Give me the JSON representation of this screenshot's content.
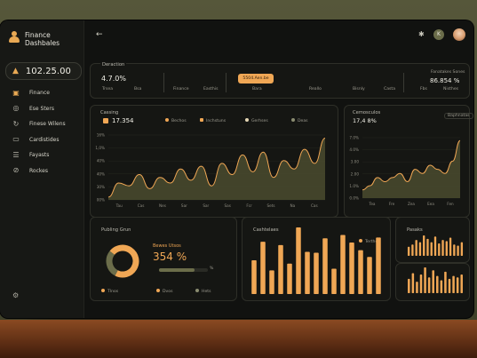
{
  "colors": {
    "accent": "#f0a755",
    "bg": "#111210",
    "panel": "#151613",
    "chart_fill": "#4a4b2f",
    "chart_line": "#f0a755"
  },
  "brand": {
    "name": "Finance Dashbales",
    "logo": "user-logo-icon"
  },
  "balance": {
    "icon": "arrow-up-icon",
    "value": "102.25.00"
  },
  "nav": [
    {
      "label": "Finance",
      "icon": "wallet-icon"
    },
    {
      "label": "Ese Sters",
      "icon": "chart-icon"
    },
    {
      "label": "Finese Wilens",
      "icon": "refresh-icon"
    },
    {
      "label": "Cardistides",
      "icon": "card-icon"
    },
    {
      "label": "Fayasts",
      "icon": "grid-icon"
    },
    {
      "label": "Rockes",
      "icon": "tag-icon"
    }
  ],
  "topbar": {
    "back": "←",
    "icon1": "sparkle-icon",
    "icon2": "K"
  },
  "summary": {
    "title": "Deraction",
    "big": "4.7.0%",
    "small_labels": [
      "Trsea",
      "Bsa"
    ],
    "mid_labels": [
      "Finance",
      "Easthis"
    ],
    "chip": "5504.Aen.be",
    "chip_sub": "Bara",
    "right_labels": [
      "Reallo",
      "Bisnly",
      "Casta"
    ],
    "right_top": "Fanatakes Sones",
    "right_big": "86.854 %",
    "right_sub": [
      "Fbs",
      "Nisthes"
    ]
  },
  "main_chart": {
    "title": "Cassing",
    "value": "17.354",
    "legend": [
      "Bechos",
      "Inchstuns",
      "Gerhses",
      "Deas"
    ]
  },
  "side_chart": {
    "title": "Cemosculos",
    "value": "17,4 8%",
    "badge": "Baphnatas"
  },
  "donut_panel": {
    "title": "Publing Grun",
    "label": "Bewes Utsos",
    "value": "354 %",
    "suffix": "%",
    "legend": [
      "Tlnos",
      "Dvos",
      "Hets"
    ]
  },
  "bar_panel": {
    "title": "Cashtelaes",
    "legend": "Terthes"
  },
  "mini_panel": {
    "title": "Pasaks"
  },
  "chart_data": [
    {
      "type": "area",
      "ylabels": [
        "16%",
        "1,0%",
        "40%",
        "40%",
        "30%",
        "00%"
      ],
      "x": [
        "Tau",
        "Cas",
        "Nes",
        "Sar",
        "Sar",
        "Sas",
        "Fcr",
        "Sets",
        "Na",
        "Cas"
      ],
      "values": [
        1,
        6,
        5,
        9,
        4,
        8,
        6,
        11,
        7,
        12,
        5,
        13,
        9,
        16,
        10,
        17,
        8,
        14,
        11,
        18,
        13,
        22
      ]
    },
    {
      "type": "area",
      "ylabels": [
        "7.0%",
        "4.0%",
        "3.00",
        "2.00",
        "1.0%",
        "0.0%"
      ],
      "x": [
        "Tea",
        "Fre",
        "Zea",
        "Eea",
        "Fen"
      ],
      "values": [
        2,
        3,
        5,
        4,
        5,
        6,
        4,
        7,
        6,
        8,
        7,
        6,
        9,
        14
      ]
    },
    {
      "type": "pie",
      "values": [
        72,
        28
      ]
    },
    {
      "type": "bar",
      "values": [
        40,
        62,
        28,
        58,
        36,
        79,
        50,
        49,
        66,
        30,
        70,
        61,
        52,
        44,
        67
      ]
    },
    {
      "type": "bar",
      "values": [
        40,
        50,
        70,
        60,
        90,
        75,
        60,
        85,
        55,
        70,
        65,
        80,
        50,
        45,
        60
      ]
    },
    {
      "type": "bar",
      "values": [
        50,
        70,
        40,
        65,
        90,
        55,
        80,
        60,
        45,
        75,
        50,
        60,
        55,
        65
      ]
    }
  ]
}
